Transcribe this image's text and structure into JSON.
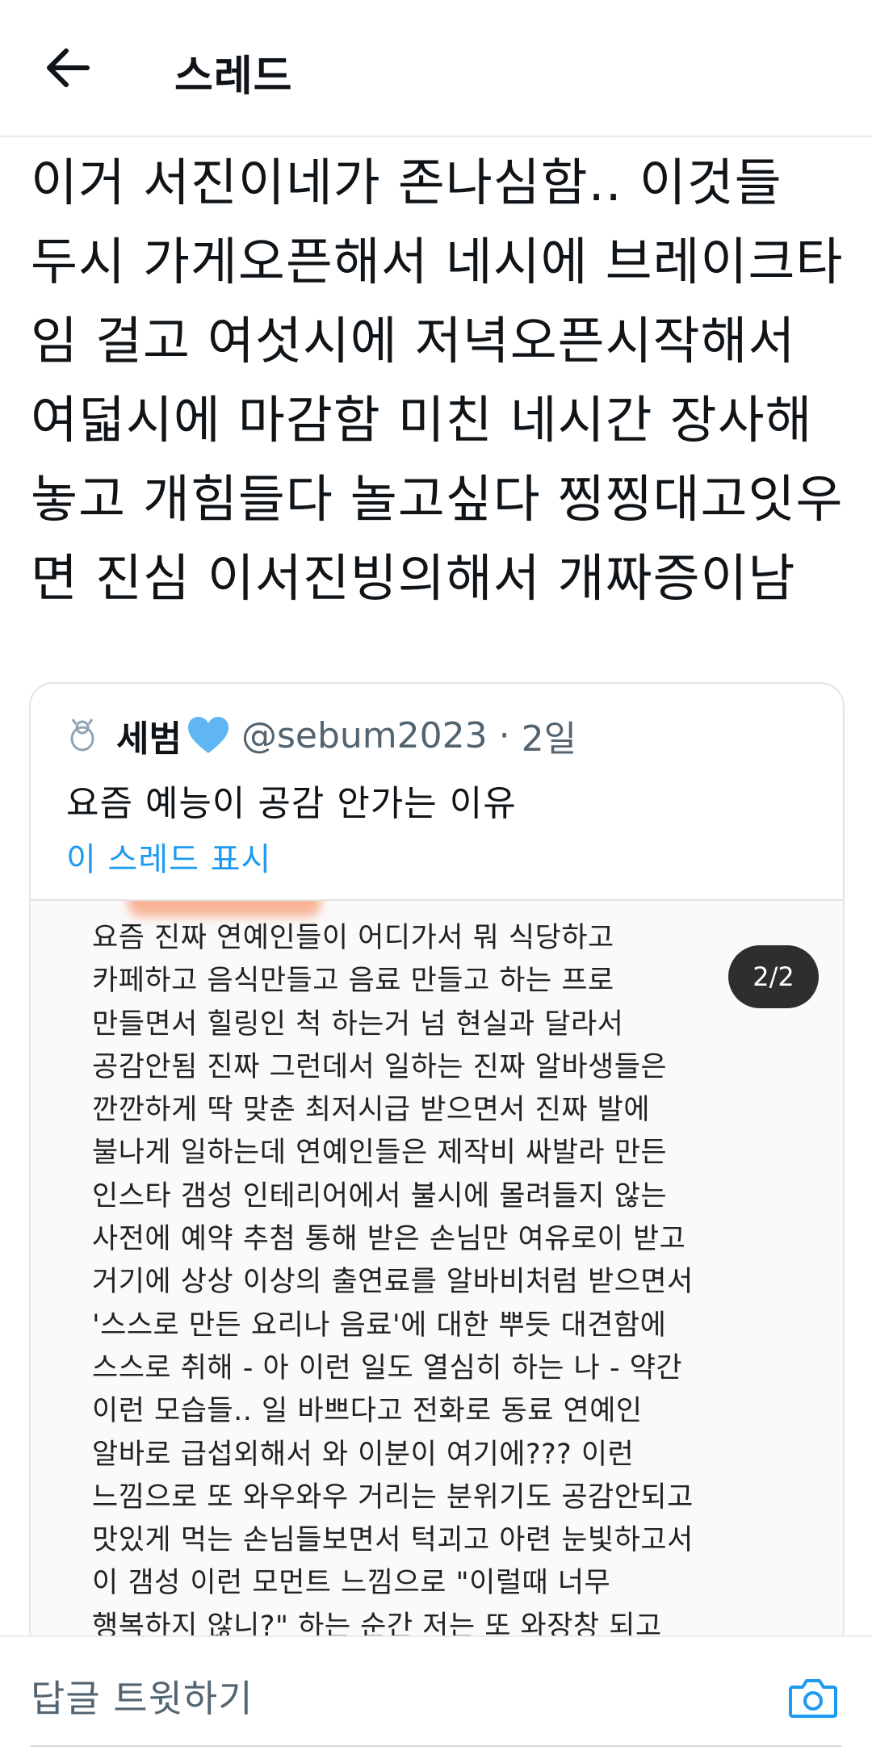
{
  "header": {
    "title": "스레드",
    "back_icon": "arrow-left-icon"
  },
  "tweet": {
    "text": "이거 서진이네가 존나심함.. 이것들 두시 가게오픈해서 네시에 브레이크타임 걸고 여섯시에 저녁오픈시작해서 여덟시에 마감함 미친 네시간 장사해놓고 개힘들다 놀고싶다 찡찡대고잇우면 진심 이서진빙의해서 개짜증이남"
  },
  "quote": {
    "author_name": "세범",
    "name_emoji": "blue-heart-icon",
    "handle": "@sebum2023",
    "separator": "·",
    "time": "2일",
    "text": "요즘 예능이 공감 안가는 이유",
    "show_thread": "이 스레드 표시",
    "image_counter": "2/2",
    "image_text": "요즘 진짜 연예인들이 어디가서 뭐 식당하고\n카페하고 음식만들고 음료 만들고 하는 프로\n만들면서 힐링인 척 하는거 넘 현실과 달라서\n공감안됨 진짜 그런데서 일하는 진짜 알바생들은\n깐깐하게 딱 맞춘 최저시급 받으면서 진짜 발에\n불나게 일하는데 연예인들은 제작비 싸발라 만든\n인스타 갬성 인테리어에서 불시에 몰려들지 않는\n사전에 예약 추첨 통해 받은 손님만 여유로이 받고\n거기에 상상 이상의 출연료를 알바비처럼 받으면서\n'스스로 만든 요리나 음료'에 대한 뿌듯 대견함에\n스스로 취해 - 아 이런 일도 열심히 하는 나 - 약간\n이런 모습들.. 일 바쁘다고 전화로 동료 연예인\n알바로 급섭외해서 와 이분이 여기에??? 이런\n느낌으로 또 와우와우 거리는 분위기도 공감안되고\n맛있게 먹는 손님들보면서 턱괴고 아련 눈빛하고서\n이 갬성 이런 모먼트 느낌으로 \"이럴때 너무\n행복하지 않니?\" 하는 순간 저는 또 와장창 되고"
  },
  "reply": {
    "placeholder": "답글 트윗하기",
    "camera_icon": "camera-icon"
  },
  "colors": {
    "link": "#1d9bf0",
    "secondary_text": "#536471",
    "border": "#e6ecf0"
  }
}
